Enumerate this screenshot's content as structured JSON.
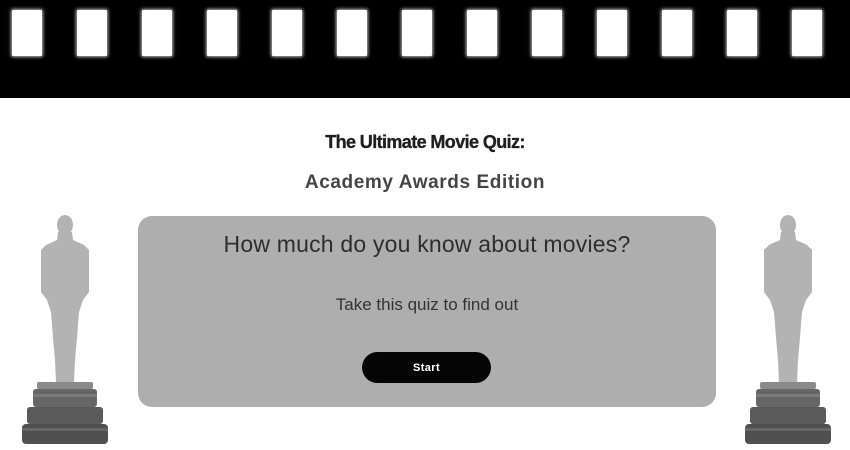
{
  "header": {
    "film_strip_icon": "film-strip"
  },
  "titles": {
    "main": "The Ultimate Movie Quiz:",
    "subtitle": "Academy Awards Edition"
  },
  "quiz_card": {
    "question": "How much do you know about movies?",
    "subtext": "Take this quiz to find out",
    "start_label": "Start"
  },
  "decorations": {
    "left_icon": "award-statuette-icon",
    "right_icon": "award-statuette-icon"
  },
  "colors": {
    "film_strip": "#000000",
    "card_background": "#aeaeae",
    "button_background": "#050505",
    "button_text": "#ffffff",
    "statuette_figure": "#b3b3b3",
    "statuette_base": "#5f5f5f"
  }
}
